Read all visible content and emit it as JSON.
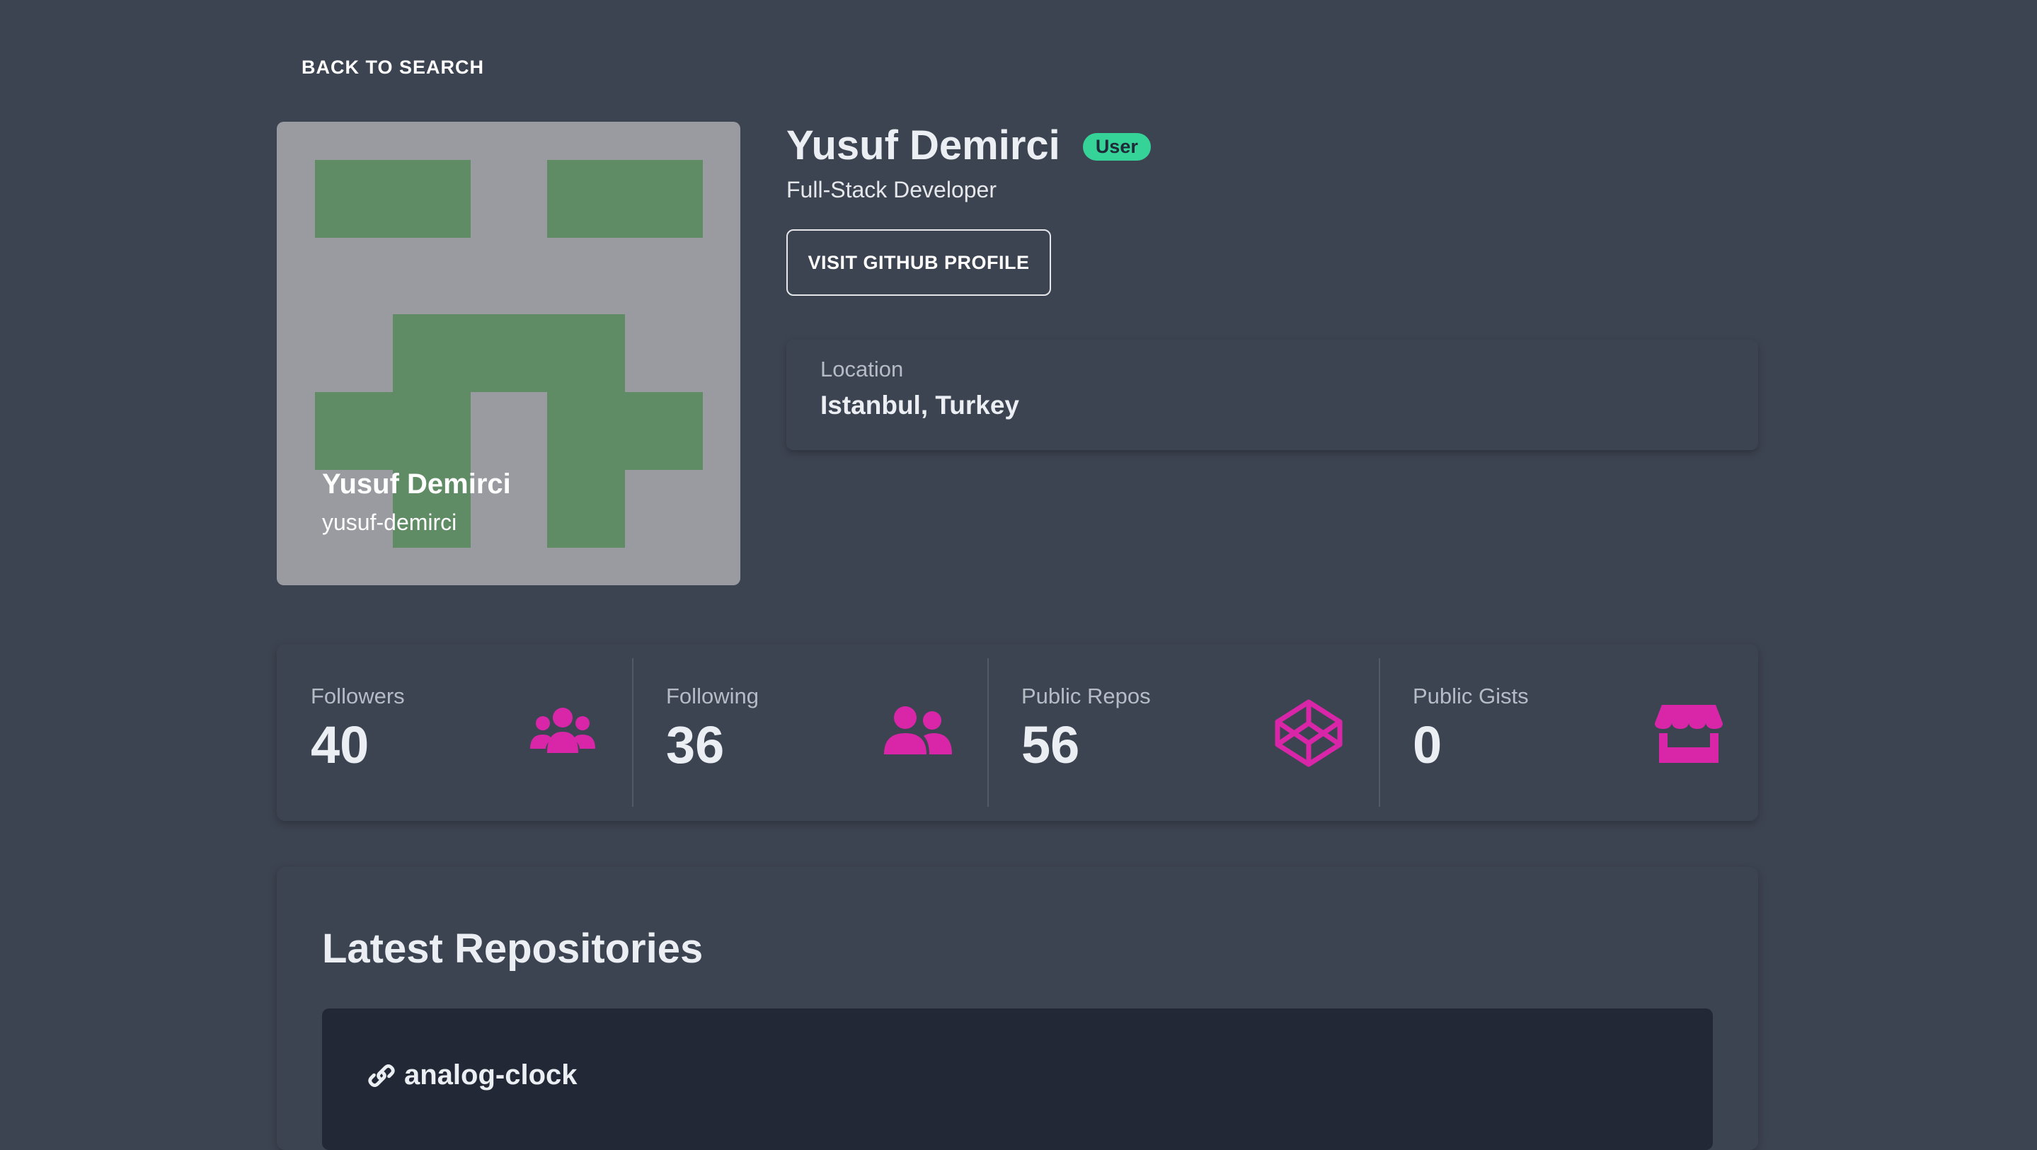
{
  "nav": {
    "back_label": "BACK TO SEARCH"
  },
  "profile": {
    "name": "Yusuf Demirci",
    "login": "yusuf-demirci",
    "type_badge": "User",
    "bio": "Full-Stack Developer",
    "github_button": "VISIT GITHUB PROFILE",
    "location_label": "Location",
    "location": "Istanbul, Turkey"
  },
  "stats": [
    {
      "title": "Followers",
      "value": "40",
      "icon": "users-group-icon"
    },
    {
      "title": "Following",
      "value": "36",
      "icon": "user-friends-icon"
    },
    {
      "title": "Public Repos",
      "value": "56",
      "icon": "codepen-icon"
    },
    {
      "title": "Public Gists",
      "value": "0",
      "icon": "store-icon"
    }
  ],
  "repositories": {
    "title": "Latest Repositories",
    "items": [
      {
        "name": "analog-clock",
        "icon": "link-icon"
      }
    ]
  },
  "colors": {
    "background": "#3d4451",
    "accent_icon": "#d926a9",
    "badge": "#36d399",
    "avatar_bg": "#9a9ba0",
    "avatar_fg": "#5f8c64",
    "repo_card": "#222836"
  }
}
